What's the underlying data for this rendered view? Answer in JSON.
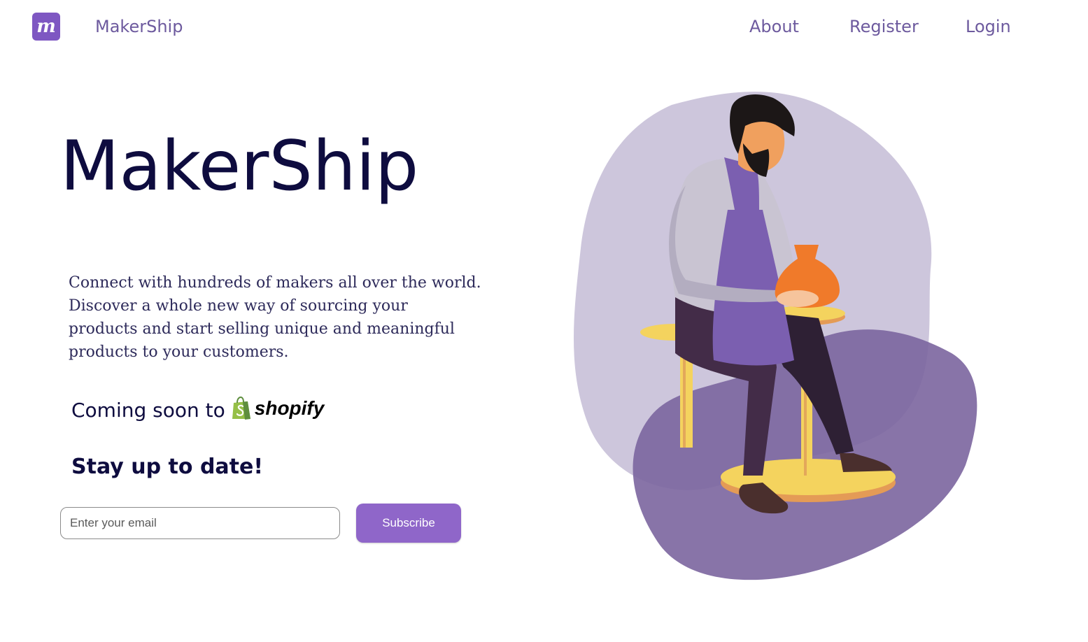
{
  "nav": {
    "logo_letter": "m",
    "brand": "MakerShip",
    "links": [
      "About",
      "Register",
      "Login"
    ]
  },
  "hero": {
    "title": "MakerShip",
    "description": "Connect with hundreds of makers all over the world. Discover a whole new way of sourcing your products and start selling unique and meaningful products to your customers.",
    "coming_soon": "Coming soon to",
    "shopify_word": "shopify"
  },
  "subscribe": {
    "title": "Stay up to date!",
    "placeholder": "Enter your email",
    "button": "Subscribe"
  },
  "colors": {
    "accent": "#8f66c9",
    "nav_text": "#6d5a9e",
    "heading": "#0e0c3f",
    "blob_light": "#cdc6dc",
    "blob_dark": "#7e6aa3",
    "shopify_green": "#95bf47"
  },
  "icons": {
    "logo": "makership-logo-icon",
    "shopify": "shopify-bag-icon",
    "illustration": "potter-illustration"
  }
}
